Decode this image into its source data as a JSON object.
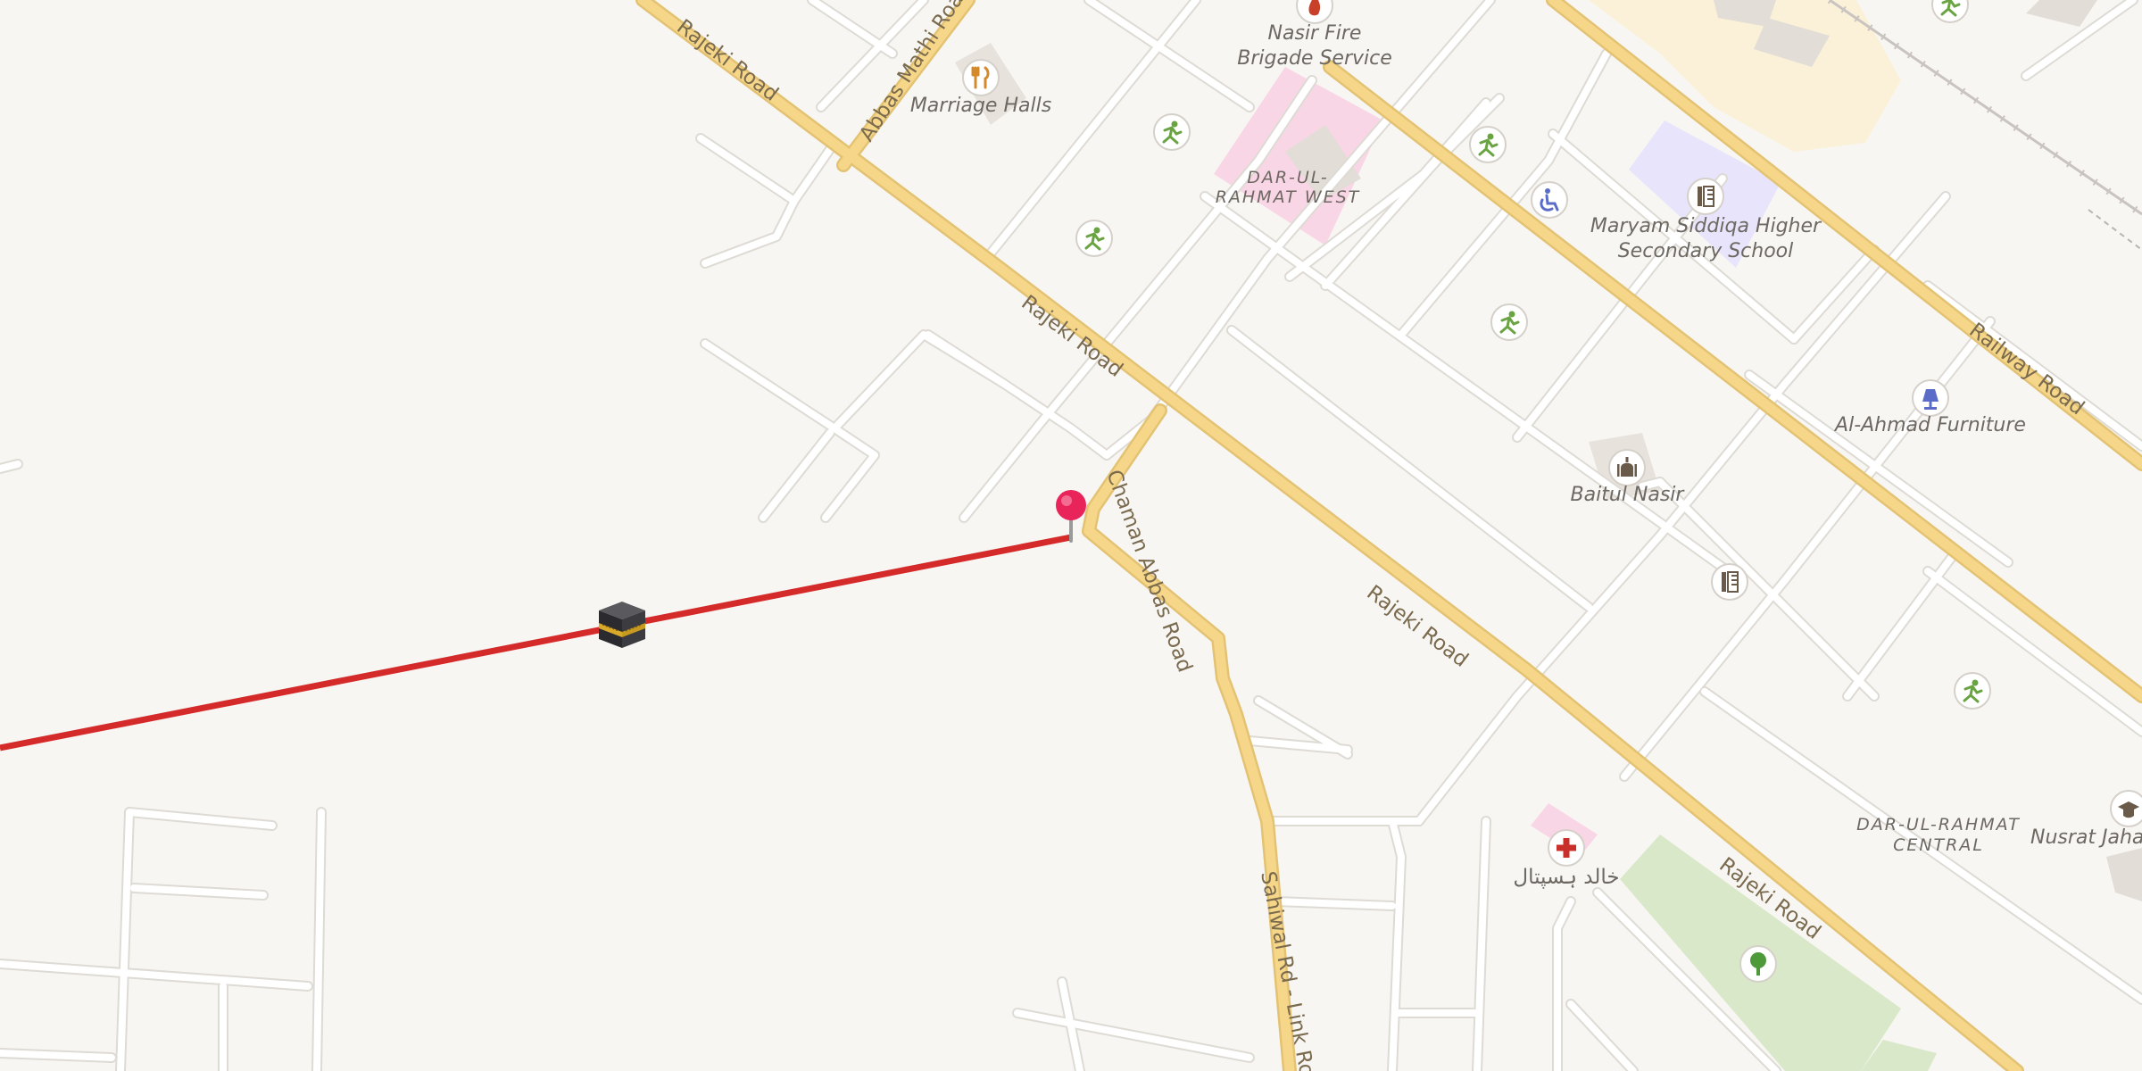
{
  "roads": {
    "rajeki_1": "Rajeki Road",
    "rajeki_2": "Rajeki Road",
    "rajeki_3": "Rajeki Road",
    "rajeki_4": "Rajeki Road",
    "abbas_mathi": "Abbas Mathi Road",
    "chaman_abbas": "Chaman Abbas Road",
    "railway": "Railway Road",
    "sahiwal": "Sahiwal Rd - Link Road"
  },
  "pois": {
    "nasir_fire_1": "Nasir Fire",
    "nasir_fire_2": "Brigade Service",
    "marriage_halls": "Marriage Halls",
    "maryam_1": "Maryam Siddiqa Higher",
    "maryam_2": "Secondary School",
    "al_ahmad": "Al-Ahmad Furniture",
    "baitul_nasir": "Baitul Nasir",
    "nusrat": "Nusrat Jahan",
    "khalid_hospital": "خالد ہسپتال"
  },
  "areas": {
    "rahmat_west_1": "DAR-UL-",
    "rahmat_west_2": "RAHMAT WEST",
    "rahmat_central_1": "DAR-UL-RAHMAT",
    "rahmat_central_2": "CENTRAL"
  },
  "icons": {
    "pin": "map-pin-icon",
    "kaaba": "kaaba-icon",
    "qibla_line_color": "#d42a2a"
  },
  "colors": {
    "background": "#f8f6f3",
    "major_road": "#f6d78a",
    "minor_road": "#ffffff",
    "park": "#d8e8c8"
  }
}
